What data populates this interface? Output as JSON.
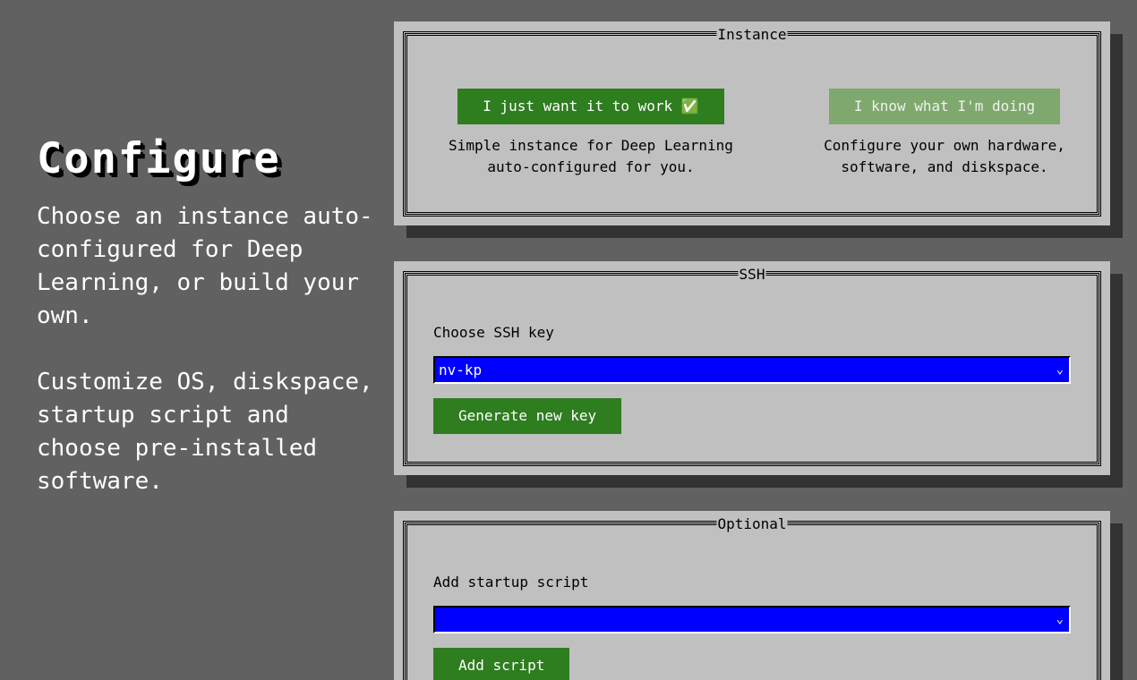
{
  "intro": {
    "title": "Configure",
    "paragraph1": "Choose an instance auto-configured for Deep Learning, or build your own.",
    "paragraph2": "Customize OS, diskspace, startup script and choose pre-installed software."
  },
  "instance": {
    "legend": "Instance",
    "simple": {
      "label": "I just want it to work ✅",
      "description": "Simple instance for Deep Learning auto-configured for you."
    },
    "custom": {
      "label": "I know what I'm doing",
      "description": "Configure your own hardware, software, and diskspace."
    }
  },
  "ssh": {
    "legend": "SSH",
    "field_label": "Choose SSH key",
    "selected_key": "nv-kp",
    "generate_label": "Generate new key"
  },
  "optional": {
    "legend": "Optional",
    "field_label": "Add startup script",
    "selected_script": "",
    "add_label": "Add script"
  },
  "colors": {
    "background": "#616161",
    "panel": "#c0c0c0",
    "accent_green": "#2e7d1f",
    "muted_green": "#7fa86f",
    "select_blue": "#0000ff"
  },
  "icons": {
    "select_chevron": "chevron-down-icon"
  }
}
